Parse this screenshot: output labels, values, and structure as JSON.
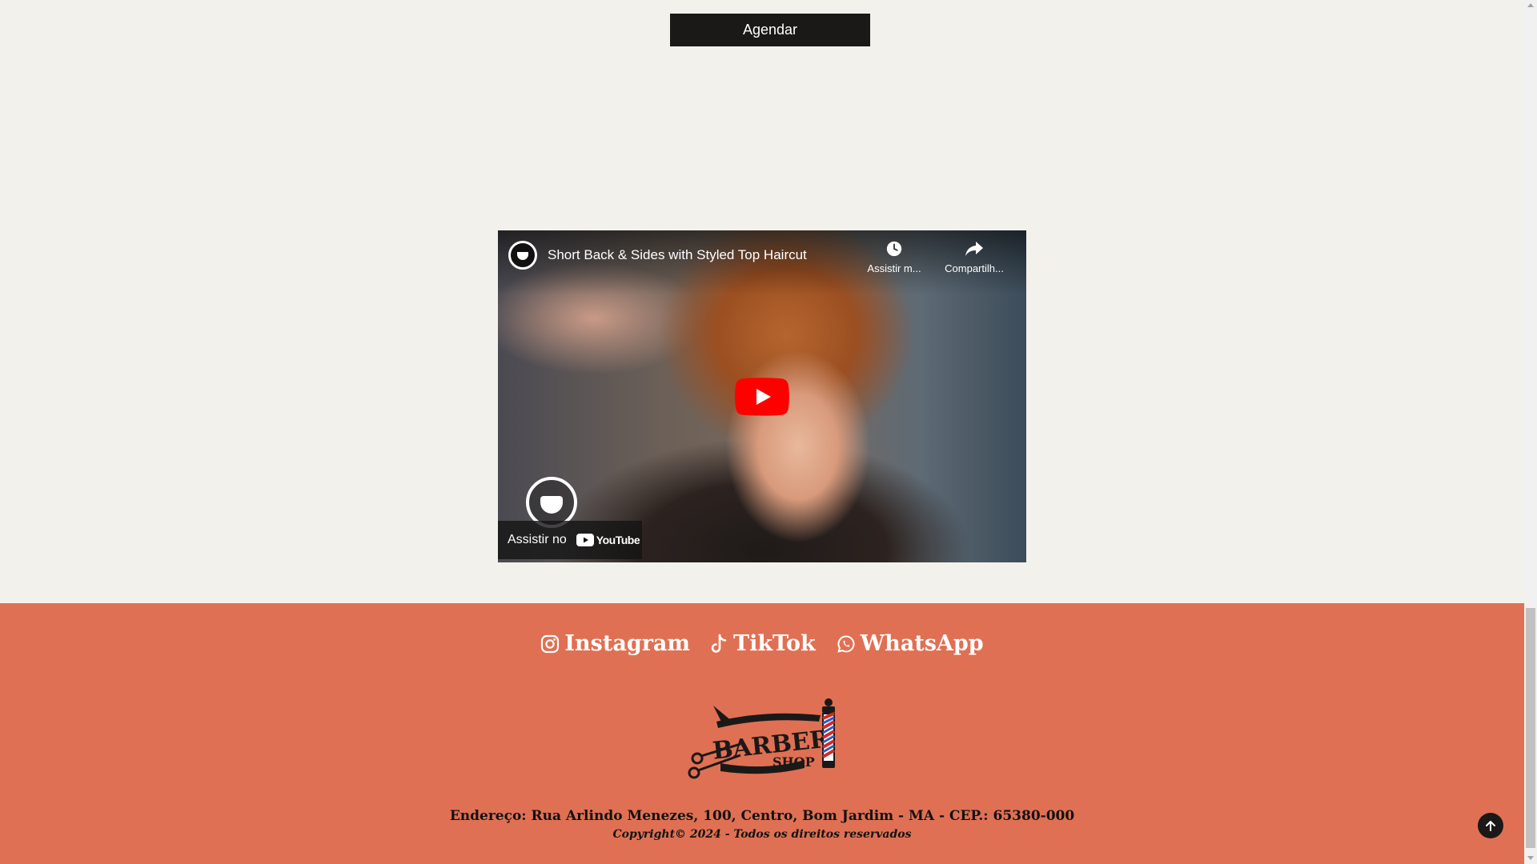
{
  "schedule": {
    "label": "Agendar"
  },
  "video": {
    "title": "Short Back & Sides with Styled Top Haircut",
    "watch_later": "Assistir m...",
    "share": "Compartilh...",
    "watch_on": "Assistir no",
    "youtube": "YouTube"
  },
  "footer": {
    "social": [
      {
        "label": "Instagram",
        "icon": "instagram-icon"
      },
      {
        "label": "TikTok",
        "icon": "tiktok-icon"
      },
      {
        "label": "WhatsApp",
        "icon": "whatsapp-icon"
      }
    ],
    "logo": {
      "top_text": "BARBER",
      "bottom_text": "SHOP"
    },
    "address": "Endereço: Rua Arlindo Menezes, 100, Centro, Bom Jardim - MA - CEP.: 65380-000",
    "copyright": "Copyright© 2024 - Todos os direitos reservados"
  },
  "colors": {
    "background": "#f3f1ec",
    "footer": "#e07053",
    "button": "#1b1918",
    "youtube_red": "#ff0000"
  }
}
